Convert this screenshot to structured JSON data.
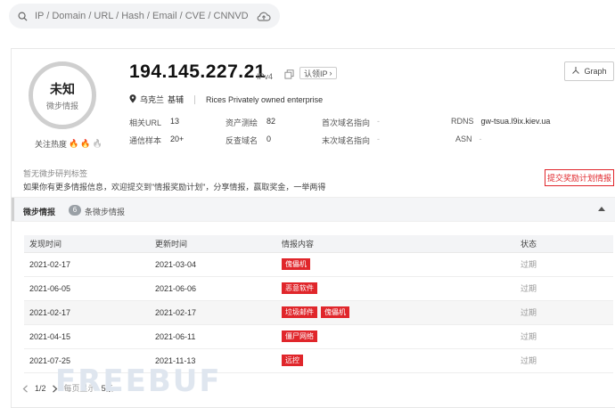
{
  "search": {
    "placeholder": "IP / Domain / URL / Hash / Email / CVE / CNNVD"
  },
  "score": {
    "value": "未知",
    "label": "微步情报"
  },
  "heat": {
    "label": "关注热度"
  },
  "ip": {
    "address": "194.145.227.21",
    "version": "IPv4",
    "claim_label": "认领IP"
  },
  "graph_label": "Graph",
  "location": {
    "country": "乌克兰",
    "city": "基辅",
    "owner": "Rices Privately owned enterprise"
  },
  "stats": [
    {
      "label": "相关URL",
      "value": "13"
    },
    {
      "label": "通信样本",
      "value": "20+"
    },
    {
      "label": "资产测绘",
      "value": "82"
    },
    {
      "label": "反查域名",
      "value": "0"
    },
    {
      "label": "首次域名指向",
      "value": "-"
    },
    {
      "label": "末次域名指向",
      "value": "-"
    },
    {
      "label": "RDNS",
      "value": "gw-tsua.l9ix.kiev.ua"
    },
    {
      "label": "ASN",
      "value": "-"
    }
  ],
  "tags_text": "暂无微步研判标签",
  "promo_text": "如果你有更多情报信息，欢迎提交到\"情报奖励计划\"，分享情报，赢取奖金，一举两得",
  "reward_button": "提交奖励计划情报",
  "section": {
    "title": "微步情报",
    "count": "6",
    "count_label": "条微步情报"
  },
  "table": {
    "headers": [
      "发现时间",
      "更新时间",
      "情报内容",
      "状态"
    ],
    "rows": [
      {
        "found": "2021-02-17",
        "updated": "2021-03-04",
        "tags": [
          "傀儡机"
        ],
        "status": "过期"
      },
      {
        "found": "2021-06-05",
        "updated": "2021-06-06",
        "tags": [
          "恶意软件"
        ],
        "status": "过期"
      },
      {
        "found": "2021-02-17",
        "updated": "2021-02-17",
        "tags": [
          "垃圾邮件",
          "傀儡机"
        ],
        "status": "过期"
      },
      {
        "found": "2021-04-15",
        "updated": "2021-06-11",
        "tags": [
          "僵尸网络"
        ],
        "status": "过期"
      },
      {
        "found": "2021-07-25",
        "updated": "2021-11-13",
        "tags": [
          "远控"
        ],
        "status": "过期"
      }
    ]
  },
  "pager": {
    "current": "1",
    "total": "2",
    "per_page_label": "每页显示",
    "per_page_value": "5条"
  },
  "watermark": "FREEBUF",
  "colors": {
    "accent": "#e0262b",
    "ring": "#cfcfcf"
  },
  "icons": [
    "search-icon",
    "cloud-upload-icon",
    "copy-icon",
    "graph-icon",
    "location-icon",
    "flame-icon",
    "chevron-left-icon",
    "chevron-right-icon",
    "caret-down-icon",
    "caret-up-icon"
  ]
}
